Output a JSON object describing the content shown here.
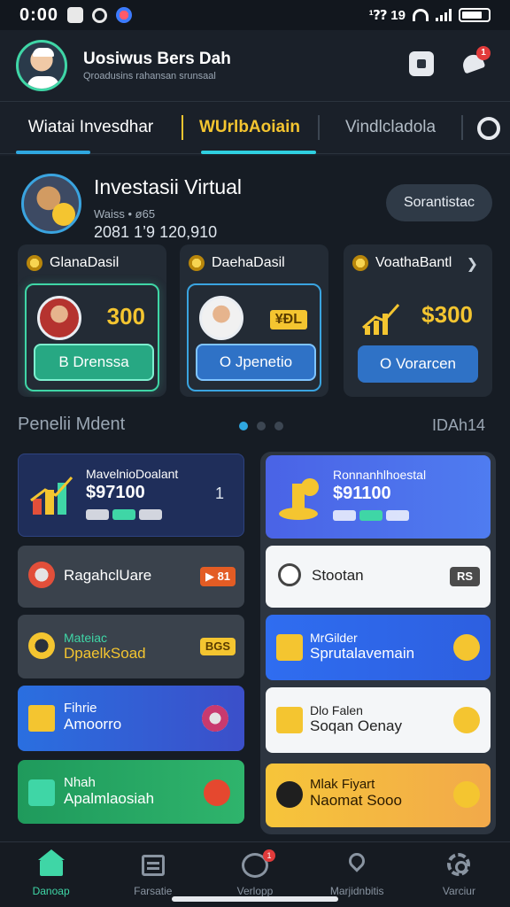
{
  "status_bar": {
    "time": "0:00",
    "right_text": "¹⁇ 19"
  },
  "header": {
    "user_name": "Uosiwus Bers Dah",
    "user_subtitle": "Qroadusins rahansan srunsaal",
    "notification_count": "1"
  },
  "tabs": [
    {
      "label": "Wiatai Invesdhar",
      "active": false
    },
    {
      "label": "WUrlbAoiain",
      "active": true
    },
    {
      "label": "Vindlcladola",
      "active": false
    }
  ],
  "profile_card": {
    "title": "Investasii Virtual",
    "subtitle": "Waiss • ø65",
    "value": "2081 1’9 120,910",
    "button_label": "Sorantistac"
  },
  "investment_cards": [
    {
      "title": "GlanaDasil",
      "amount": "300",
      "button_label": "B Drenssa"
    },
    {
      "title": "DaehaDasil",
      "amount": "¥ÐL",
      "button_label": "O Jpenetio"
    },
    {
      "title": "VoathaBantl",
      "amount": "$300",
      "button_label": "O Vorarcen"
    }
  ],
  "section": {
    "label": "Penelii Mdent",
    "right_label": "IDAh14"
  },
  "left_items": [
    {
      "label": "MavelnioDoalant",
      "value": "$97100",
      "trailing": "1"
    },
    {
      "label": "RagahclUare",
      "badge": "▶ 81"
    },
    {
      "label": "Mateiac",
      "label2": "DpaelkSoad",
      "badge": "BGS"
    },
    {
      "label": "Fihrie",
      "label2": "Amoorro"
    },
    {
      "label": "Nhah",
      "label2": "Apalmlaosiah"
    }
  ],
  "right_items": [
    {
      "label": "Ronnanhlhoestal",
      "value": "$91100"
    },
    {
      "label": "Stootan",
      "badge": "RS"
    },
    {
      "label": "MrGilder",
      "label2": "Sprutalavemain"
    },
    {
      "label": "Dlo Falen",
      "label2": "Soqan Oenay"
    },
    {
      "label": "Mlak Fiyart",
      "label2": "Naomat Sooo"
    }
  ],
  "bottom_nav": [
    {
      "label": "Danoap",
      "icon": "home-icon",
      "active": true
    },
    {
      "label": "Farsatie",
      "icon": "list-icon",
      "active": false
    },
    {
      "label": "Verlopp",
      "icon": "chat-icon",
      "active": false,
      "badge": "1"
    },
    {
      "label": "Marjidnbitis",
      "icon": "location-icon",
      "active": false
    },
    {
      "label": "Varciur",
      "icon": "gear-icon",
      "active": false
    }
  ],
  "colors": {
    "background": "#1a2029",
    "accent_green": "#3fd6a6",
    "accent_blue": "#2fa7e0",
    "accent_gold": "#f4c530"
  }
}
